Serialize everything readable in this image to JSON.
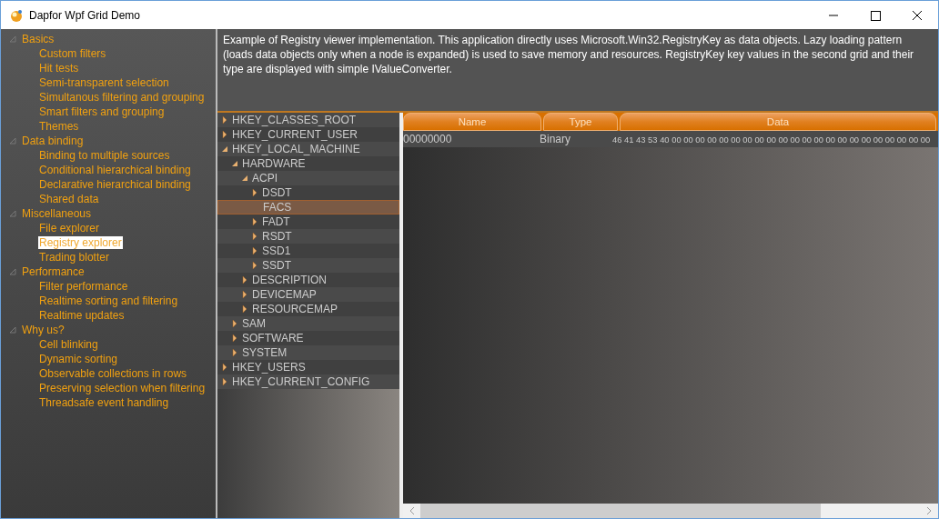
{
  "window": {
    "title": "Dapfor Wpf Grid Demo"
  },
  "sidebar": {
    "groups": [
      {
        "label": "Basics",
        "expanded": true,
        "items": [
          {
            "label": "Custom filters",
            "selected": false
          },
          {
            "label": "Hit tests",
            "selected": false
          },
          {
            "label": "Semi-transparent selection",
            "selected": false
          },
          {
            "label": "Simultanous filtering and grouping",
            "selected": false
          },
          {
            "label": "Smart filters and grouping",
            "selected": false
          },
          {
            "label": "Themes",
            "selected": false
          }
        ]
      },
      {
        "label": "Data binding",
        "expanded": true,
        "items": [
          {
            "label": "Binding to multiple sources",
            "selected": false
          },
          {
            "label": "Conditional hierarchical binding",
            "selected": false
          },
          {
            "label": "Declarative hierarchical binding",
            "selected": false
          },
          {
            "label": "Shared data",
            "selected": false
          }
        ]
      },
      {
        "label": "Miscellaneous",
        "expanded": true,
        "items": [
          {
            "label": "File explorer",
            "selected": false
          },
          {
            "label": "Registry explorer",
            "selected": true
          },
          {
            "label": "Trading blotter",
            "selected": false
          }
        ]
      },
      {
        "label": "Performance",
        "expanded": true,
        "items": [
          {
            "label": "Filter performance",
            "selected": false
          },
          {
            "label": "Realtime sorting and filtering",
            "selected": false
          },
          {
            "label": "Realtime updates",
            "selected": false
          }
        ]
      },
      {
        "label": "Why us?",
        "expanded": true,
        "items": [
          {
            "label": "Cell blinking",
            "selected": false
          },
          {
            "label": "Dynamic sorting",
            "selected": false
          },
          {
            "label": "Observable collections in rows",
            "selected": false
          },
          {
            "label": "Preserving selection when filtering",
            "selected": false
          },
          {
            "label": "Threadsafe event handling",
            "selected": false
          }
        ]
      }
    ]
  },
  "description": "Example of Registry viewer implementation. This application directly uses Microsoft.Win32.RegistryKey as data objects. Lazy loading pattern (loads data objects only when a node is expanded) is used to save memory and resources. RegistryKey key values in the second grid and their type are displayed with simple IValueConverter.",
  "registry_tree": [
    {
      "label": "HKEY_CLASSES_ROOT",
      "expanded": false,
      "selected": false
    },
    {
      "label": "HKEY_CURRENT_USER",
      "expanded": false,
      "selected": false
    },
    {
      "label": "HKEY_LOCAL_MACHINE",
      "expanded": true,
      "selected": false,
      "children": [
        {
          "label": "HARDWARE",
          "expanded": true,
          "selected": false,
          "children": [
            {
              "label": "ACPI",
              "expanded": true,
              "selected": false,
              "children": [
                {
                  "label": "DSDT",
                  "expanded": false,
                  "selected": false
                },
                {
                  "label": "FACS",
                  "selected": true
                },
                {
                  "label": "FADT",
                  "expanded": false,
                  "selected": false
                },
                {
                  "label": "RSDT",
                  "expanded": false,
                  "selected": false
                },
                {
                  "label": "SSD1",
                  "expanded": false,
                  "selected": false
                },
                {
                  "label": "SSDT",
                  "expanded": false,
                  "selected": false
                }
              ]
            },
            {
              "label": "DESCRIPTION",
              "expanded": false,
              "selected": false
            },
            {
              "label": "DEVICEMAP",
              "expanded": false,
              "selected": false
            },
            {
              "label": "RESOURCEMAP",
              "expanded": false,
              "selected": false
            }
          ]
        },
        {
          "label": "SAM",
          "expanded": false,
          "selected": false
        },
        {
          "label": "SOFTWARE",
          "expanded": false,
          "selected": false
        },
        {
          "label": "SYSTEM",
          "expanded": false,
          "selected": false
        }
      ]
    },
    {
      "label": "HKEY_USERS",
      "expanded": false,
      "selected": false
    },
    {
      "label": "HKEY_CURRENT_CONFIG",
      "expanded": false,
      "selected": false
    }
  ],
  "values_grid": {
    "columns": [
      "Name",
      "Type",
      "Data"
    ],
    "rows": [
      {
        "name": "00000000",
        "type": "Binary",
        "data": "46 41 43 53 40 00 00 00 00 00 00 00 00 00 00 00 00 00 00 00 00 00 00 00 00 00 00"
      }
    ]
  }
}
